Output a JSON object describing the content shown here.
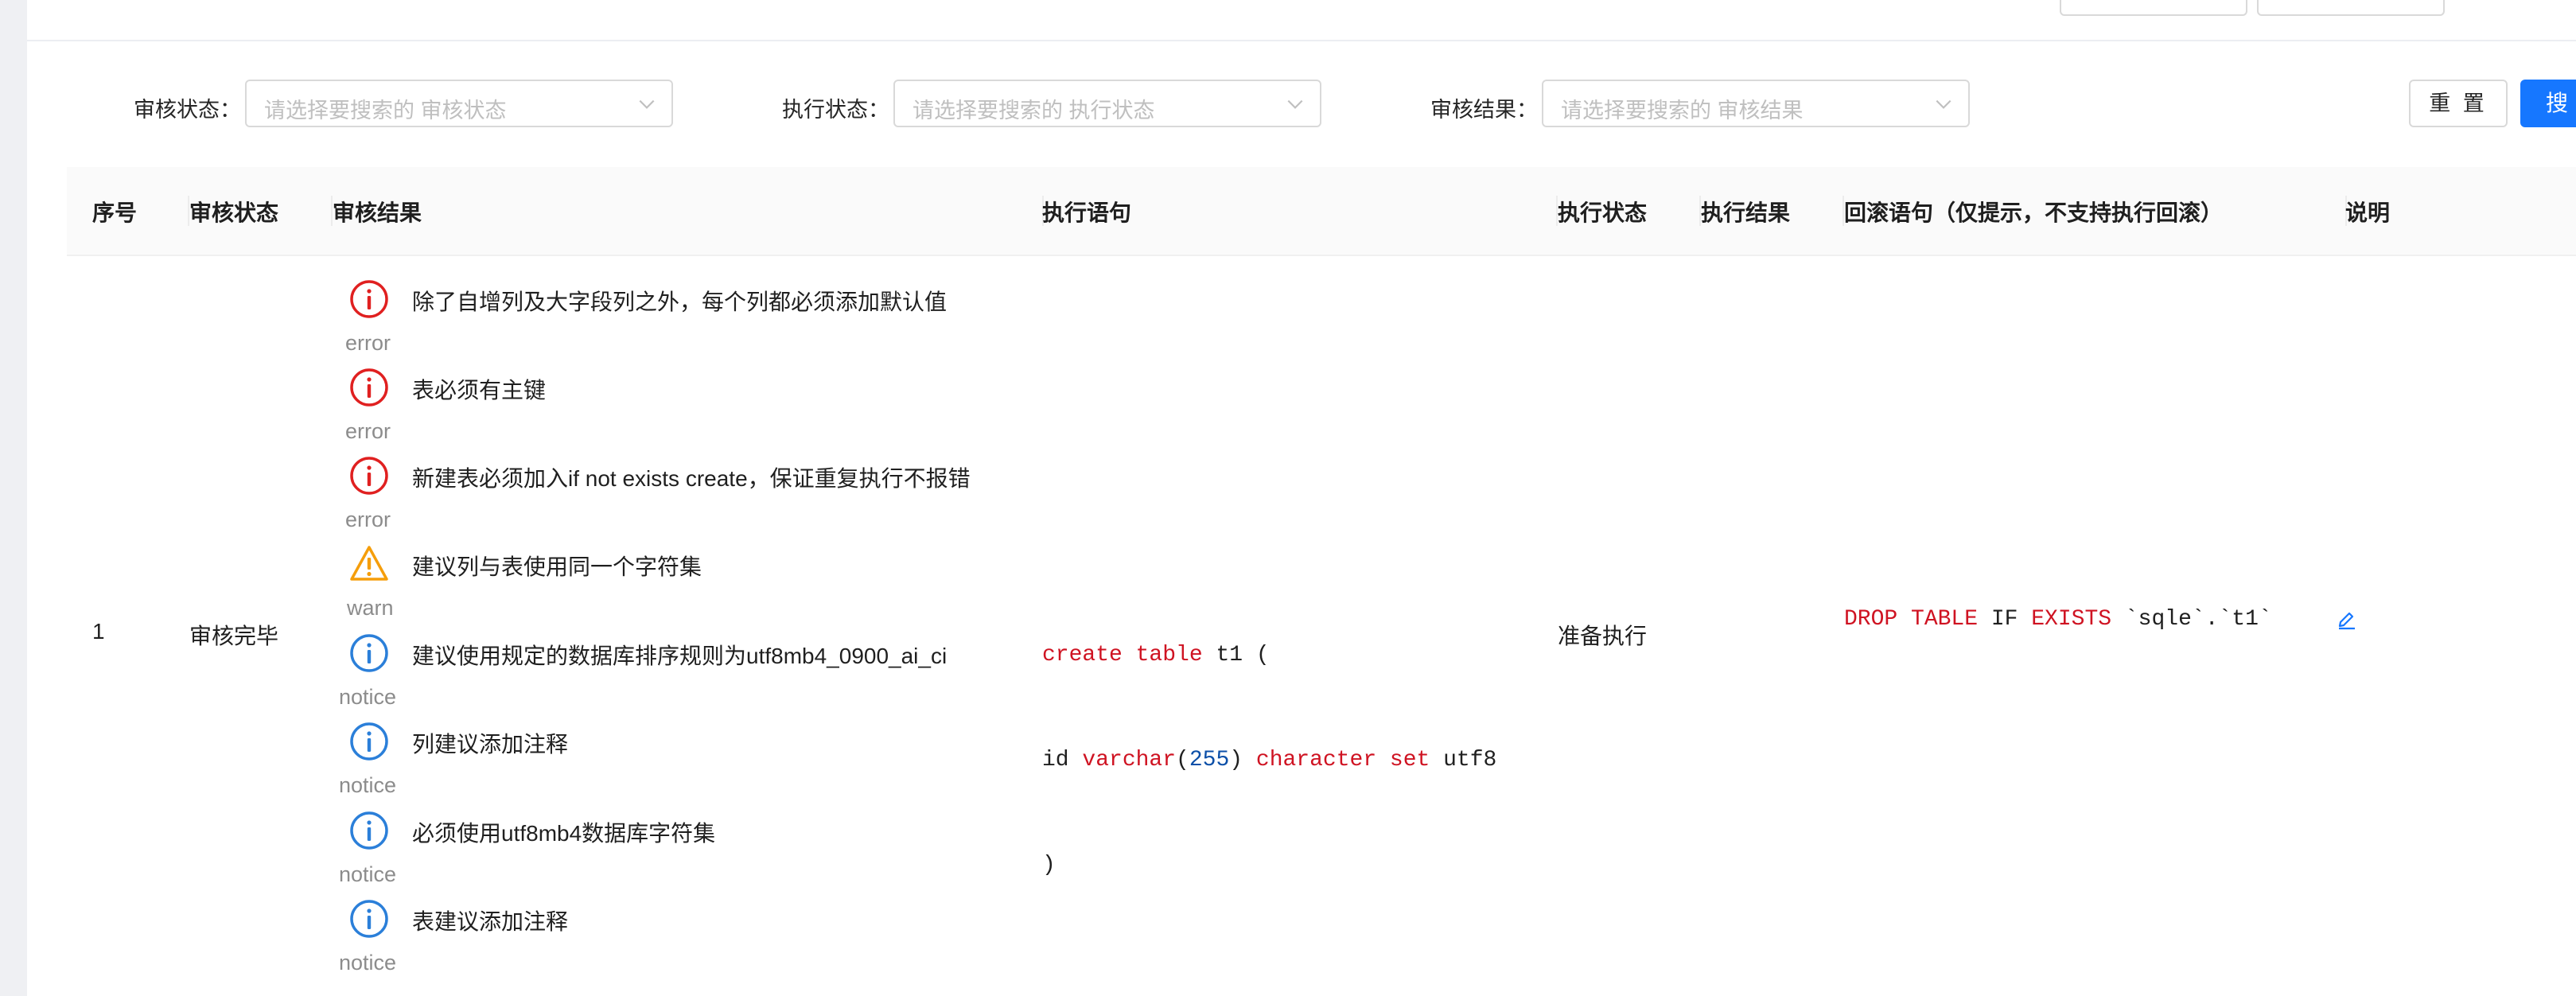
{
  "filters": {
    "audit_status": {
      "label": "审核状态：",
      "placeholder": "请选择要搜索的 审核状态"
    },
    "exec_status": {
      "label": "执行状态：",
      "placeholder": "请选择要搜索的 执行状态"
    },
    "audit_result": {
      "label": "审核结果：",
      "placeholder": "请选择要搜索的 审核结果"
    },
    "reset_label": "重 置",
    "search_label": "搜"
  },
  "table": {
    "columns": [
      "序号",
      "审核状态",
      "审核结果",
      "执行语句",
      "执行状态",
      "执行结果",
      "回滚语句（仅提示，不支持执行回滚）",
      "说明"
    ],
    "rows": [
      {
        "index": "1",
        "audit_status": "审核完毕",
        "audit_results": [
          {
            "level": "error",
            "icon": "error-circle-icon",
            "message": "除了自增列及大字段列之外，每个列都必须添加默认值"
          },
          {
            "level": "error",
            "icon": "error-circle-icon",
            "message": "表必须有主键"
          },
          {
            "level": "error",
            "icon": "error-circle-icon",
            "message": "新建表必须加入if not exists create，保证重复执行不报错"
          },
          {
            "level": "warn",
            "icon": "warning-triangle-icon",
            "message": "建议列与表使用同一个字符集"
          },
          {
            "level": "notice",
            "icon": "info-circle-icon",
            "message": "建议使用规定的数据库排序规则为utf8mb4_0900_ai_ci"
          },
          {
            "level": "notice",
            "icon": "info-circle-icon",
            "message": "列建议添加注释"
          },
          {
            "level": "notice",
            "icon": "info-circle-icon",
            "message": "必须使用utf8mb4数据库字符集"
          },
          {
            "level": "notice",
            "icon": "info-circle-icon",
            "message": "表建议添加注释"
          }
        ],
        "exec_sql": {
          "line1": {
            "kw1": "create table",
            "rest": " t1 ("
          },
          "line2": {
            "pre": "id ",
            "kw1": "varchar",
            "p1": "(",
            "num": "255",
            "p2": ") ",
            "kw2": "character set",
            "rest": " utf8"
          },
          "line3": ")"
        },
        "exec_status": "准备执行",
        "exec_result": "",
        "rollback_sql": {
          "kw1": "DROP TABLE",
          "mid": " IF ",
          "kw2": "EXISTS",
          "rest": " `sqle`.`t1`"
        },
        "note_icon": "edit-icon"
      }
    ]
  },
  "colors": {
    "primary": "#1677ff",
    "error": "#e02020",
    "warn": "#f59e0b",
    "notice": "#2b7fd9",
    "keyword": "#cf1322"
  }
}
